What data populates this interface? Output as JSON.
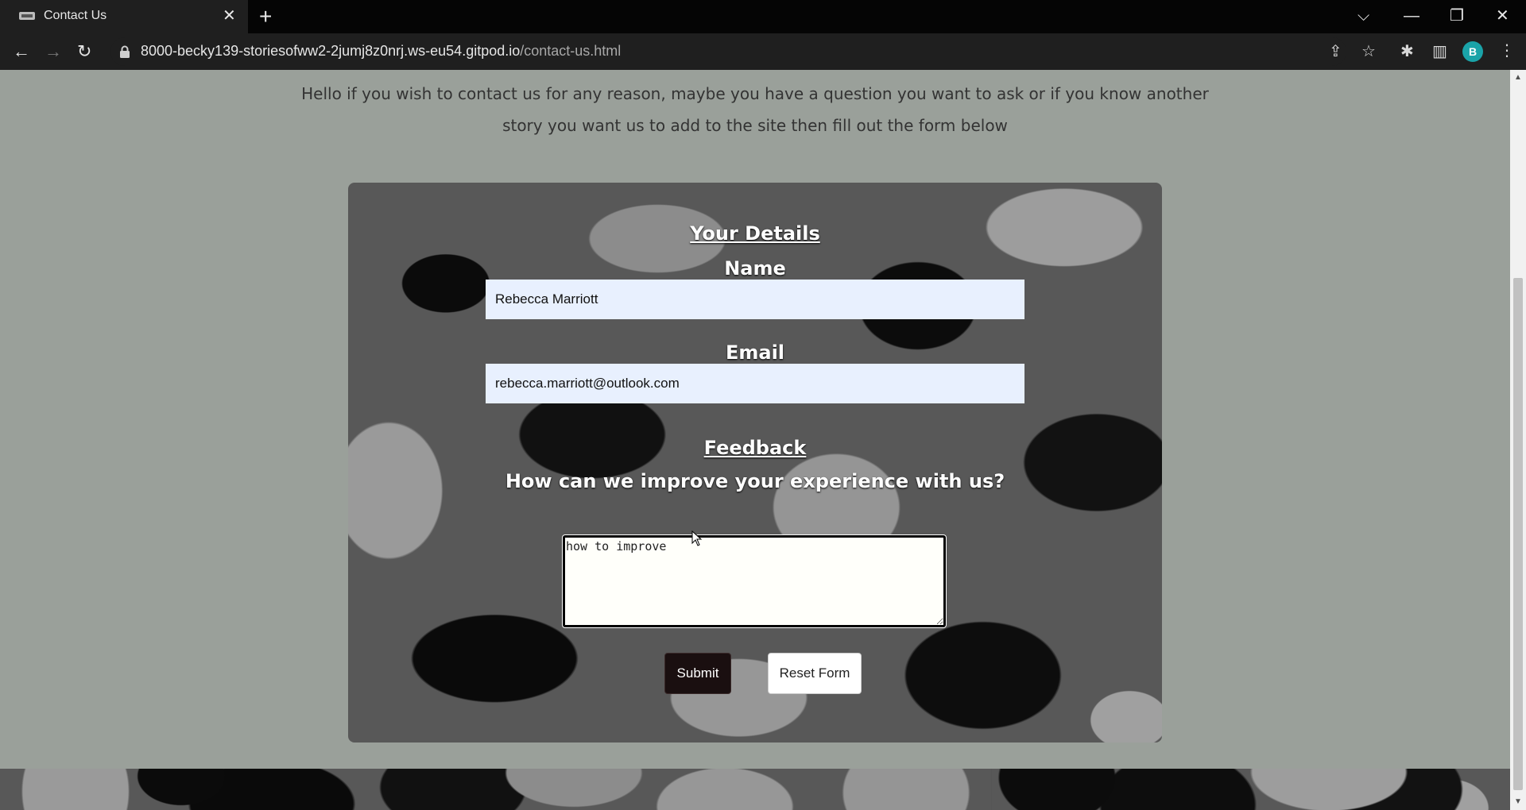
{
  "browser": {
    "tab_title": "Contact Us",
    "tab_close": "✕",
    "new_tab": "+",
    "url_host": "8000-becky139-storiesofww2-2jumj8z0nrj.ws-eu54.gitpod.io",
    "url_path": "/contact-us.html",
    "profile_initial": "B",
    "window_controls": {
      "dropdown": "⌵",
      "minimize": "—",
      "restore": "❐",
      "close": "✕"
    },
    "nav": {
      "back": "←",
      "forward": "→",
      "reload": "↻"
    },
    "icons": {
      "share": "⇪",
      "star": "☆",
      "extensions": "✱",
      "sidepanel": "▥",
      "menu": "⋮"
    }
  },
  "page": {
    "intro_text": "Hello if you wish to contact us for any reason, maybe you have a question you want to ask or if you know another story you want us to add to the site then fill out the form below",
    "form": {
      "details_heading": "Your Details",
      "name_label": "Name",
      "name_value": "Rebecca Marriott",
      "email_label": "Email",
      "email_value": "rebecca.marriott@outlook.com",
      "feedback_heading": "Feedback",
      "feedback_question": "How can we improve your experience with us?",
      "feedback_value": "how to improve",
      "submit_label": "Submit",
      "reset_label": "Reset Form"
    }
  },
  "colors": {
    "page_bg": "#9aa09a",
    "input_bg": "#e8f0fe",
    "submit_bg": "#1a0f10",
    "profile_bg": "#1aa3a8"
  }
}
